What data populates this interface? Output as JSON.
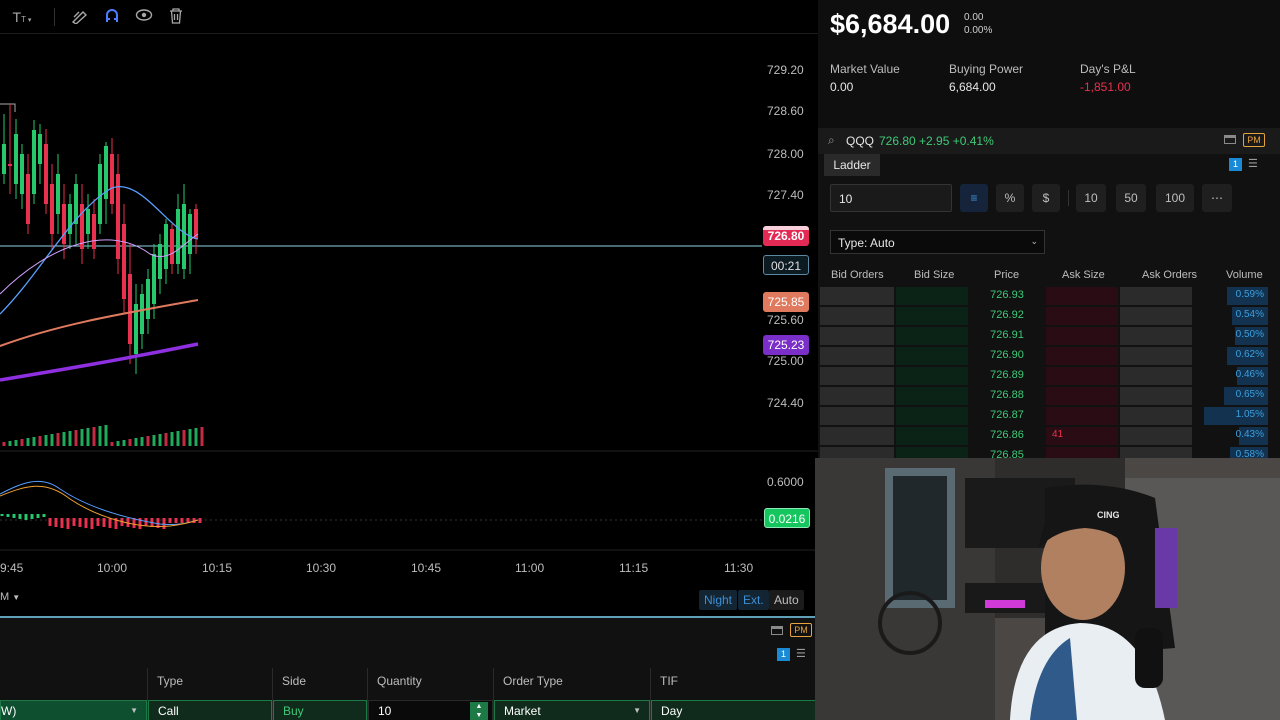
{
  "toolbar": {
    "icons": [
      "text-tool-icon",
      "draw-tool-icon",
      "magnet-icon",
      "eye-icon",
      "trash-icon"
    ]
  },
  "chart": {
    "price_axis": [
      "729.20",
      "728.60",
      "728.00",
      "727.40",
      "725.60",
      "725.00",
      "724.40"
    ],
    "tags": {
      "last": "726.80",
      "countdown": "00:21",
      "ema": "725.85",
      "vwap": "725.23",
      "macd": "0.0216"
    },
    "macd_axis": "0.6000",
    "time_axis": [
      "9:45",
      "10:00",
      "10:15",
      "10:30",
      "10:45",
      "11:00",
      "11:15",
      "11:30"
    ],
    "bottom_left": "M",
    "modes": [
      "Night",
      "Ext.",
      "Auto"
    ],
    "colors": {
      "up": "#26c86b",
      "down": "#e8314f",
      "last_tag": "#e32a55",
      "ema_tag": "#e07a5f",
      "vwap_tag": "#7b2fc9",
      "macd_tag": "#15c55e"
    }
  },
  "account": {
    "balance": "$6,684.00",
    "balance_change": "0.00",
    "balance_change_pct": "0.00%",
    "market_value_label": "Market Value",
    "market_value": "0.00",
    "buying_power_label": "Buying Power",
    "buying_power": "6,684.00",
    "days_pl_label": "Day's P&L",
    "days_pl": "-1,851.00"
  },
  "ladder": {
    "symbol": "QQQ",
    "quote": "726.80 +2.95 +0.41%",
    "pm_badge": "PM",
    "tab": "Ladder",
    "tab_badge": "1",
    "quantity": "10",
    "quick_qty": [
      "10",
      "50",
      "100"
    ],
    "more": "⋯",
    "type_select": "Type: Auto",
    "columns": [
      "Bid Orders",
      "Bid Size",
      "Price",
      "Ask Size",
      "Ask Orders",
      "Volume"
    ],
    "rows": [
      {
        "price": "726.93",
        "ask_size": "",
        "volume": "0.59%"
      },
      {
        "price": "726.92",
        "ask_size": "",
        "volume": "0.54%"
      },
      {
        "price": "726.91",
        "ask_size": "",
        "volume": "0.50%"
      },
      {
        "price": "726.90",
        "ask_size": "",
        "volume": "0.62%"
      },
      {
        "price": "726.89",
        "ask_size": "",
        "volume": "0.46%"
      },
      {
        "price": "726.88",
        "ask_size": "",
        "volume": "0.65%"
      },
      {
        "price": "726.87",
        "ask_size": "",
        "volume": "1.05%"
      },
      {
        "price": "726.86",
        "ask_size": "41",
        "volume": "0.43%"
      },
      {
        "price": "726.85",
        "ask_size": "",
        "volume": "0.58%"
      }
    ]
  },
  "order": {
    "pm_badge": "PM",
    "badge": "1",
    "headers": [
      "Type",
      "Side",
      "Quantity",
      "Order Type",
      "TIF"
    ],
    "first_cell": "W)",
    "type": "Call",
    "side": "Buy",
    "quantity": "10",
    "order_type": "Market",
    "tif": "Day"
  },
  "webcam": {
    "chair_text": "CING"
  }
}
